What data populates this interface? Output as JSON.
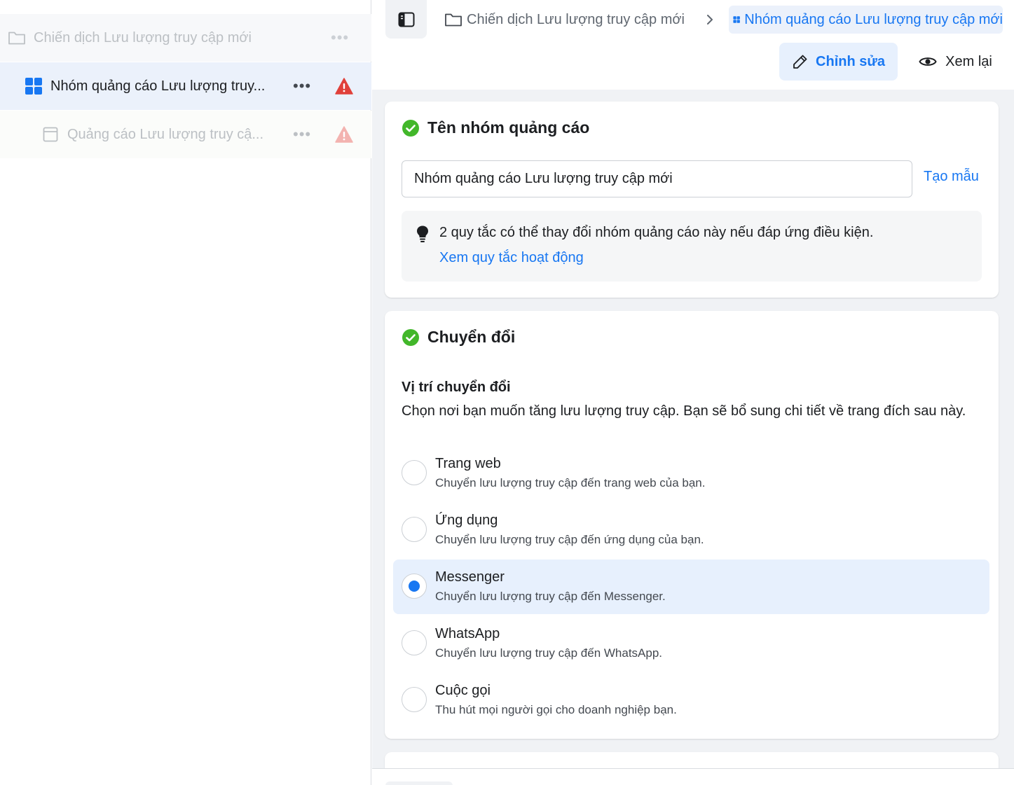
{
  "tree": {
    "campaign_label": "Chiến dịch Lưu lượng truy cập mới",
    "adset_label": "Nhóm quảng cáo Lưu lượng truy...",
    "ad_label": "Quảng cáo Lưu lượng truy cậ...",
    "more": "•••"
  },
  "header": {
    "breadcrumb_campaign": "Chiến dịch Lưu lượng truy cập mới",
    "breadcrumb_adset": "Nhóm quảng cáo Lưu lượng truy cập mới",
    "edit_label": "Chỉnh sửa",
    "review_label": "Xem lại"
  },
  "adset_name_section": {
    "title": "Tên nhóm quảng cáo",
    "input_value": "Nhóm quảng cáo Lưu lượng truy cập mới",
    "template_link": "Tạo mẫu",
    "rules_message": "2 quy tắc có thể thay đổi nhóm quảng cáo này nếu đáp ứng điều kiện.",
    "rules_link": "Xem quy tắc hoạt động"
  },
  "conversion_section": {
    "title": "Chuyển đổi",
    "location_title": "Vị trí chuyển đổi",
    "location_desc": "Chọn nơi bạn muốn tăng lưu lượng truy cập. Bạn sẽ bổ sung chi tiết về trang đích sau này.",
    "options": [
      {
        "title": "Trang web",
        "desc": "Chuyển lưu lượng truy cập đến trang web của bạn.",
        "selected": false
      },
      {
        "title": "Ứng dụng",
        "desc": "Chuyển lưu lượng truy cập đến ứng dụng của bạn.",
        "selected": false
      },
      {
        "title": "Messenger",
        "desc": "Chuyển lưu lượng truy cập đến Messenger.",
        "selected": true
      },
      {
        "title": "WhatsApp",
        "desc": "Chuyển lưu lượng truy cập đến WhatsApp.",
        "selected": false
      },
      {
        "title": "Cuộc gọi",
        "desc": "Thu hút mọi người gọi cho doanh nghiệp bạn.",
        "selected": false
      }
    ]
  },
  "colors": {
    "accent": "#1877f2",
    "success": "#42b72a",
    "warning": "#e0403a"
  }
}
